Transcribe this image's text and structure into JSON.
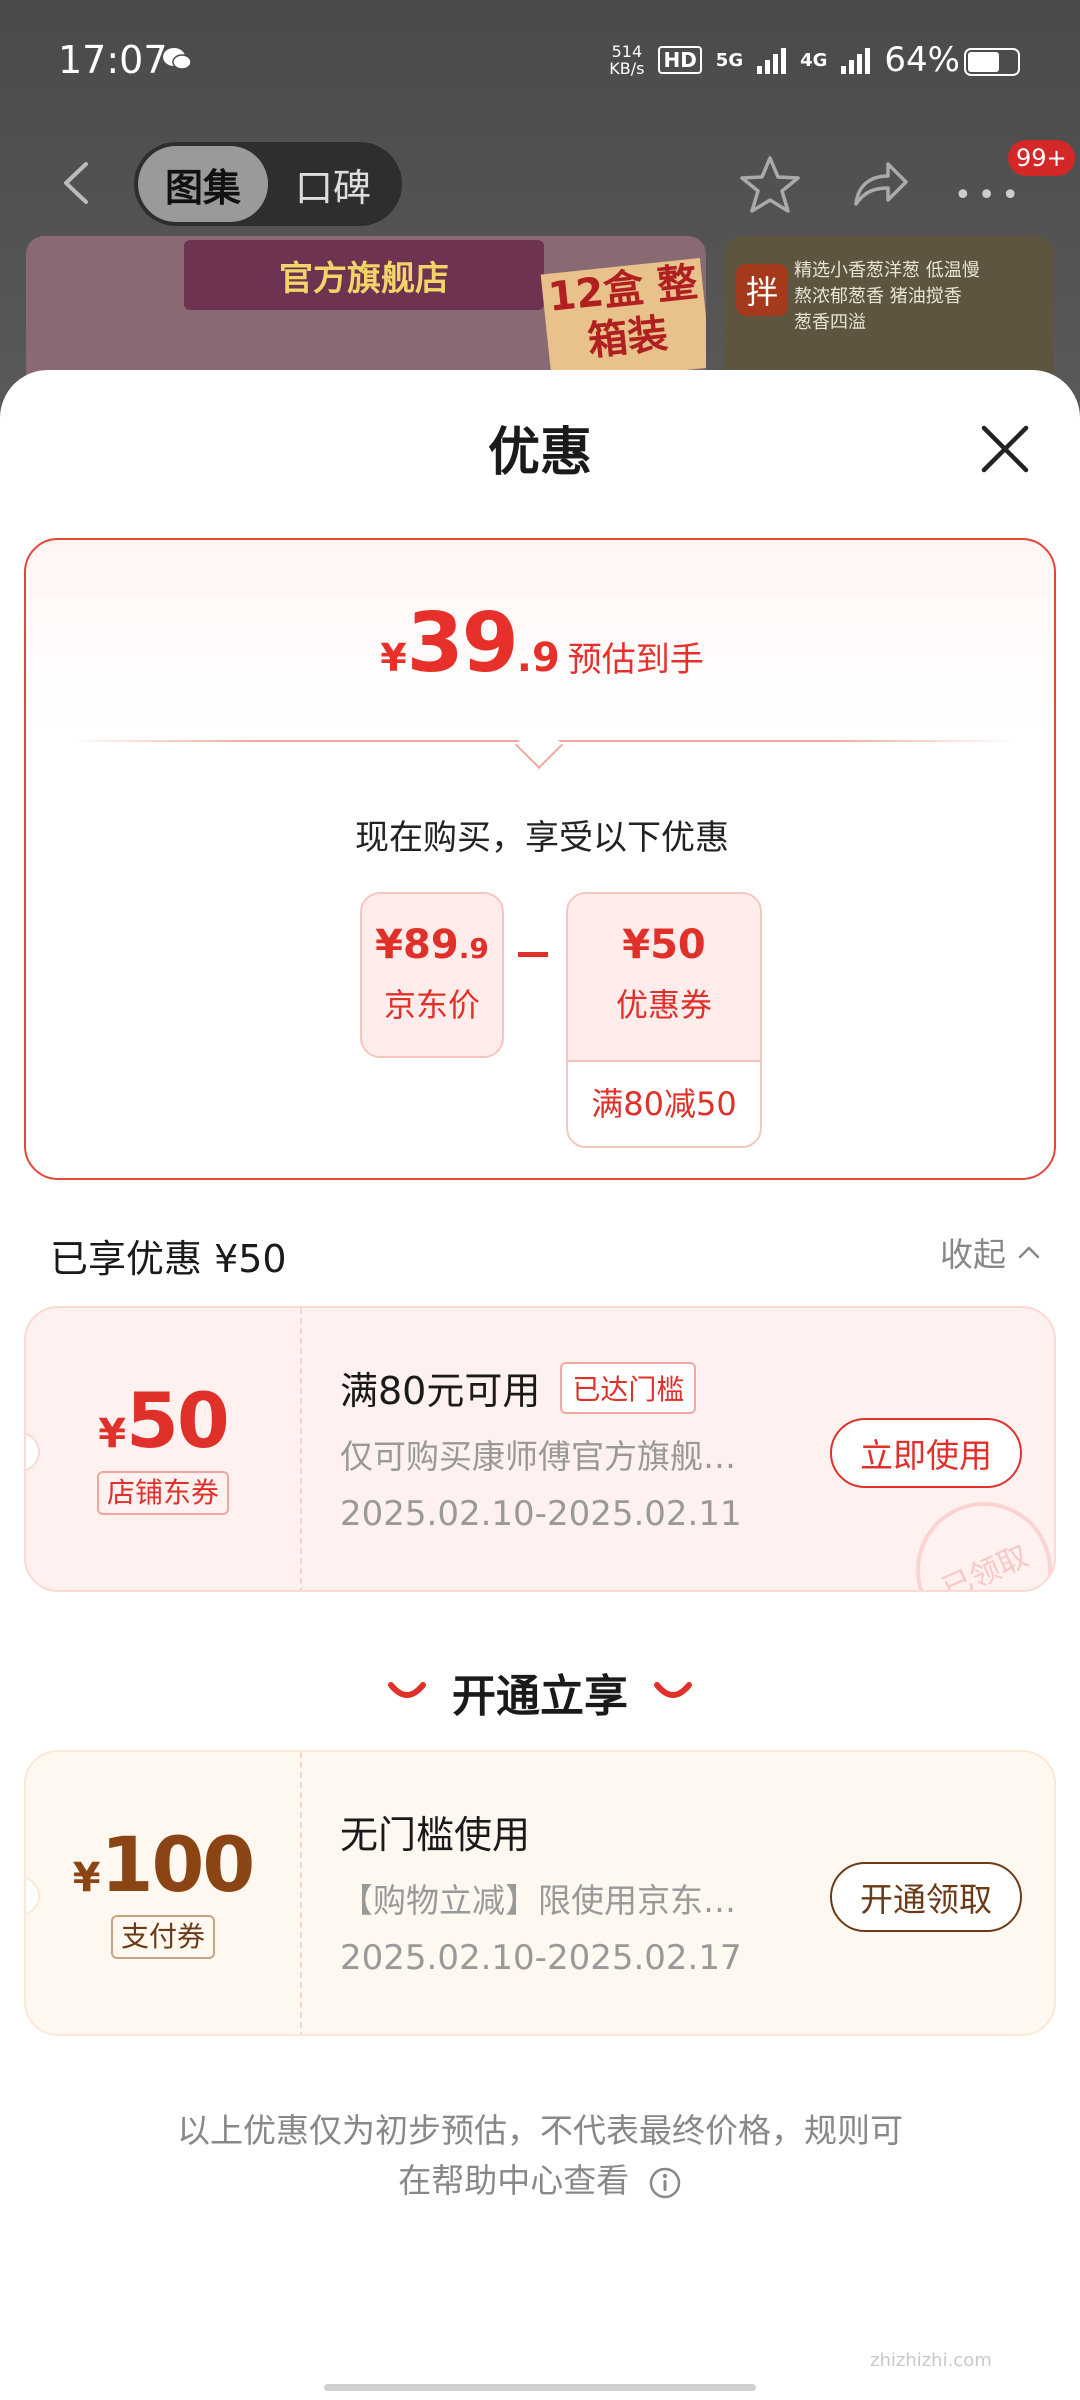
{
  "status_bar": {
    "time": "17:07",
    "net_speed_value": "514",
    "net_speed_unit": "KB/s",
    "hd_label": "HD",
    "net_5g": "5G",
    "net_4g": "4G",
    "battery_percent": "64%",
    "battery_level": 0.64
  },
  "nav": {
    "tabs": [
      {
        "label": "图集",
        "active": true
      },
      {
        "label": "口碑",
        "active": false
      }
    ],
    "badge": "99+"
  },
  "background_product": {
    "banner_text": "官方旗舰店",
    "box_text": "12盒 整箱装",
    "side_tag": "拌",
    "side_text": "精选小香葱洋葱 低温慢熬浓郁葱香 猪油搅香 葱香四溢"
  },
  "sheet": {
    "title": "优惠",
    "summary": {
      "final_price_symbol": "¥",
      "final_price_int": "39",
      "final_price_dec": ".9",
      "final_price_label": "预估到手",
      "intro": "现在购买，享受以下优惠",
      "jd_price_symbol": "¥",
      "jd_price_int": "89",
      "jd_price_dec": ".9",
      "jd_price_label": "京东价",
      "coupon_value": "¥50",
      "coupon_label": "优惠券",
      "coupon_rule": "满80减50"
    },
    "enjoyed": {
      "title": "已享优惠 ¥50",
      "collapse_label": "收起"
    },
    "store_coupon": {
      "symbol": "¥",
      "amount": "50",
      "tag": "店铺东券",
      "title": "满80元可用",
      "badge": "已达门槛",
      "desc": "仅可购买康师傅官方旗舰…",
      "date_range": "2025.02.10-2025.02.11",
      "button": "立即使用",
      "stamp": "已领取"
    },
    "open_section": {
      "title": "开通立享"
    },
    "pay_coupon": {
      "symbol": "¥",
      "amount": "100",
      "tag": "支付券",
      "title": "无门槛使用",
      "desc": "【购物立减】限使用京东…",
      "date_range": "2025.02.10-2025.02.17",
      "button": "开通领取"
    },
    "disclaimer_line1": "以上优惠仅为初步预估，不代表最终价格，规则可",
    "disclaimer_line2": "在帮助中心查看"
  },
  "watermark": "zhizhizhi.com",
  "colors": {
    "accent": "#e0302a",
    "pay_brown": "#6b3a16"
  }
}
